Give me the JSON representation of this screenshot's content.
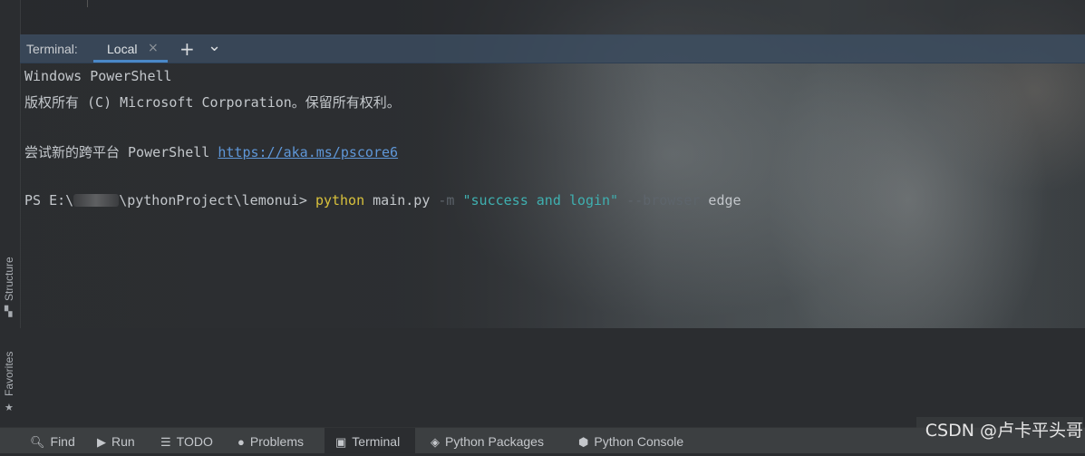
{
  "left_strip": {
    "structure_label": "Structure",
    "favorites_label": "Favorites"
  },
  "terminal": {
    "title": "Terminal:",
    "tab_label": "Local",
    "add_label": "+",
    "dropdown_label": "⌄"
  },
  "console": {
    "line1": "Windows PowerShell",
    "line2": "版权所有 (C) Microsoft Corporation。保留所有权利。",
    "line3_prefix": "尝试新的跨平台 PowerShell ",
    "line3_link": "https://aka.ms/pscore6",
    "prompt_prefix": "PS E:\\",
    "prompt_suffix": "\\pythonProject\\lemonui> ",
    "cmd_python": "python",
    "cmd_script": " main.py ",
    "cmd_flag_m": "-m",
    "cmd_string": "\"success and login\"",
    "cmd_flag_browser": "--browser",
    "cmd_edge": " edge"
  },
  "bottom_bar": {
    "find": "Find",
    "run": "Run",
    "todo": "TODO",
    "problems": "Problems",
    "terminal": "Terminal",
    "python_packages": "Python Packages",
    "python_console": "Python Console"
  },
  "watermark": "CSDN @卢卡平头哥"
}
